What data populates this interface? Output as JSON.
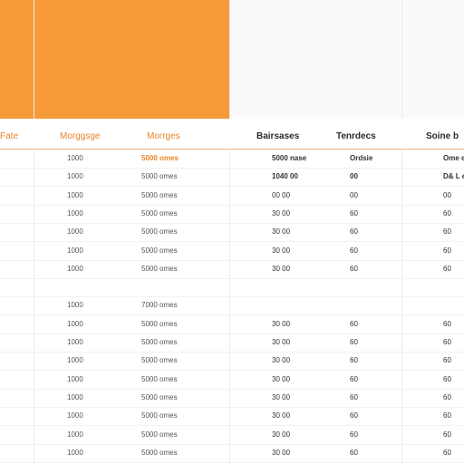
{
  "table": {
    "headers": [
      "Fate",
      "Morggsge",
      "Morrges",
      "Bairsases",
      "Tenrdecs",
      "Soine b"
    ],
    "rows": [
      [
        "",
        "1000",
        "5000 omes",
        "5000 nase",
        "Ordsie",
        "Ome e"
      ],
      [
        "",
        "1000",
        "5000 omes",
        "1040 00",
        "00",
        "D& L e"
      ],
      [
        "",
        "1000",
        "5000 omes",
        "00 00",
        "00",
        "00"
      ],
      [
        "",
        "1000",
        "5000 omes",
        "30 00",
        "60",
        "60"
      ],
      [
        "",
        "1000",
        "5000 omes",
        "30 00",
        "60",
        "60"
      ],
      [
        "",
        "1000",
        "5000 omes",
        "30 00",
        "60",
        "60"
      ],
      [
        "",
        "1000",
        "5000 omes",
        "30 00",
        "60",
        "60"
      ],
      [
        "",
        "",
        "",
        "",
        "",
        ""
      ],
      [
        "",
        "1000",
        "7000 omes",
        "",
        "",
        ""
      ],
      [
        "",
        "1000",
        "5000 omes",
        "30 00",
        "60",
        "60"
      ],
      [
        "",
        "1000",
        "5000 omes",
        "30 00",
        "60",
        "60"
      ],
      [
        "",
        "1000",
        "5000 omes",
        "30 00",
        "60",
        "60"
      ],
      [
        "",
        "1000",
        "5000 omes",
        "30 00",
        "60",
        "60"
      ],
      [
        "",
        "1000",
        "5000 omes",
        "30 00",
        "60",
        "60"
      ],
      [
        "",
        "1000",
        "5000 omes",
        "30 00",
        "60",
        "60"
      ],
      [
        "",
        "1000",
        "5000 omes",
        "30 00",
        "60",
        "60"
      ],
      [
        "",
        "1000",
        "5000 omes",
        "30 00",
        "60",
        "60"
      ]
    ]
  }
}
